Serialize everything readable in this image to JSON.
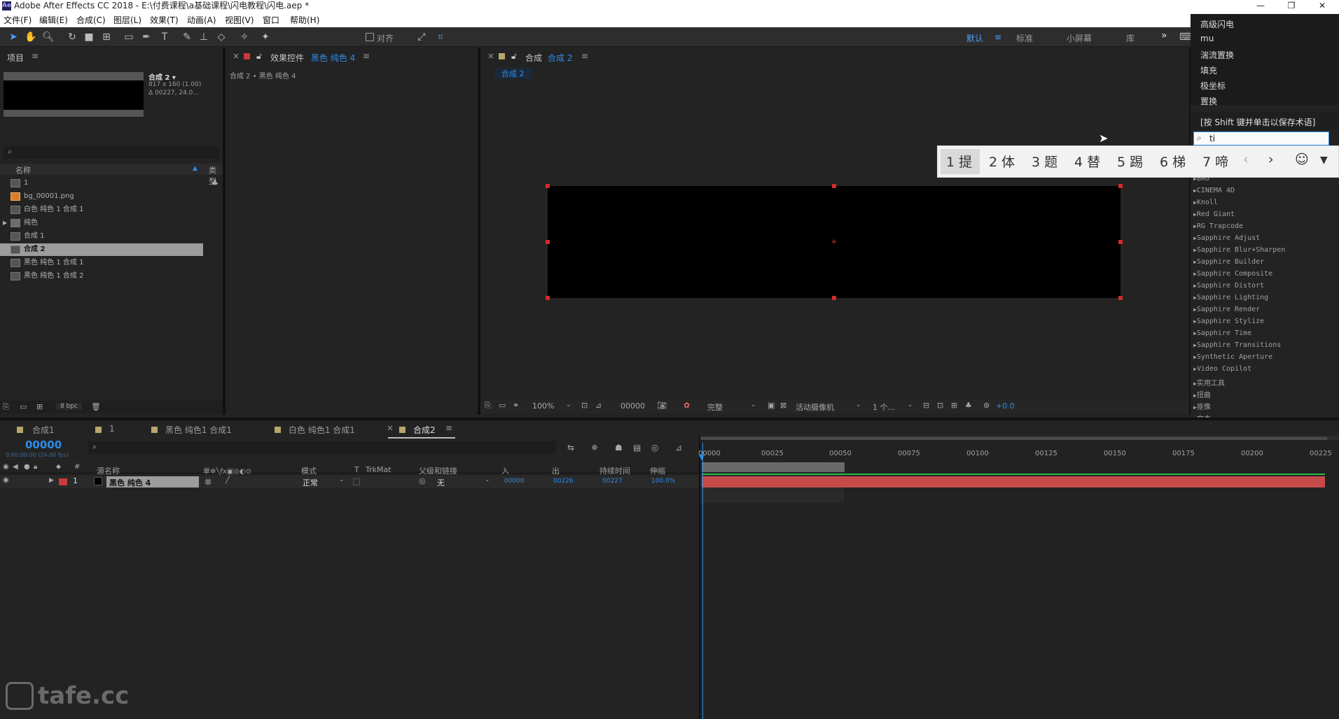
{
  "window": {
    "title": "Adobe After Effects CC 2018 - E:\\付费课程\\a基础课程\\闪电教程\\闪电.aep *",
    "controls": [
      "—",
      "❐",
      "✕"
    ]
  },
  "menu": [
    "文件(F)",
    "编辑(E)",
    "合成(C)",
    "图层(L)",
    "效果(T)",
    "动画(A)",
    "视图(V)",
    "窗口",
    "帮助(H)"
  ],
  "toolbar": {
    "align_label": "对齐",
    "workspaces": [
      "默认",
      "标准",
      "小屏幕",
      "库"
    ],
    "more": "»"
  },
  "project": {
    "title": "项目",
    "preview": {
      "name": "合成 2 ▾",
      "dims": "817 x 160 (1.00)",
      "duration": "Δ 00227, 24.0..."
    },
    "col_name": "名称",
    "col_type": "类型",
    "items": [
      {
        "name": "1",
        "icon": "composition-icon"
      },
      {
        "name": "bg_00001.png",
        "icon": "image-file-icon"
      },
      {
        "name": "白色 纯色 1 合成 1",
        "icon": "composition-icon"
      },
      {
        "name": "纯色",
        "icon": "folder-icon"
      },
      {
        "name": "合成 1",
        "icon": "composition-icon"
      },
      {
        "name": "合成 2",
        "icon": "composition-icon",
        "selected": true
      },
      {
        "name": "黑色 纯色 1 合成 1",
        "icon": "composition-icon"
      },
      {
        "name": "黑色 纯色 1 合成 2",
        "icon": "composition-icon"
      }
    ],
    "bpc": "8 bpc"
  },
  "effect_controls": {
    "title": "效果控件",
    "layer": "黑色 纯色 4",
    "breadcrumb": "合成 2 • 黑色 纯色 4"
  },
  "composition": {
    "title": "合成",
    "name": "合成 2",
    "tab": "合成 2",
    "zoom": "100%",
    "timecode": "00000",
    "quality": "完整",
    "camera": "活动摄像机",
    "views": "1 个...",
    "exposure": "+0.0"
  },
  "fx_panel": {
    "menu_items": [
      "高级闪电",
      "mu",
      "湍流置换",
      "填充",
      "极坐标",
      "置换"
    ],
    "hint": "[按 Shift 键并单击以保存术语]",
    "search_value": "ti",
    "categories": [
      "BAO",
      "CINEMA 4D",
      "Knoll",
      "Red Giant",
      "RG Trapcode",
      "Sapphire Adjust",
      "Sapphire Blur+Sharpen",
      "Sapphire Builder",
      "Sapphire Composite",
      "Sapphire Distort",
      "Sapphire Lighting",
      "Sapphire Render",
      "Sapphire Stylize",
      "Sapphire Time",
      "Sapphire Transitions",
      "Synthetic Aperture",
      "Video Copilot",
      "实用工具",
      "扭曲",
      "抠像",
      "文本"
    ]
  },
  "ime": {
    "candidates": [
      "1 提",
      "2 体",
      "3 题",
      "4 替",
      "5 踢",
      "6 梯",
      "7 啼"
    ]
  },
  "timeline": {
    "tabs": [
      "合成1",
      "1",
      "黑色 纯色1 合成1",
      "白色 纯色1 合成1",
      "合成2"
    ],
    "timecode": "00000",
    "timecode_sub": "0:00:00:00 (24.00 fps)",
    "columns": [
      "源名称",
      "模式",
      "T",
      "TrkMat",
      "父级和链接",
      "入",
      "出",
      "持续时间",
      "伸缩"
    ],
    "layer": {
      "num": "1",
      "name": "黑色 纯色 4",
      "mode": "正常",
      "parent": "无",
      "in": "00000",
      "out": "00226",
      "duration": "00227",
      "stretch": "100.0%"
    },
    "ticks": [
      "00000",
      "00025",
      "00050",
      "00075",
      "00100",
      "00125",
      "00150",
      "00175",
      "00200",
      "00225"
    ]
  },
  "watermark": "tafe.cc",
  "colors": {
    "accent": "#2d8ceb",
    "layer_bar": "#c64a4a",
    "handle": "#d02b2b"
  }
}
